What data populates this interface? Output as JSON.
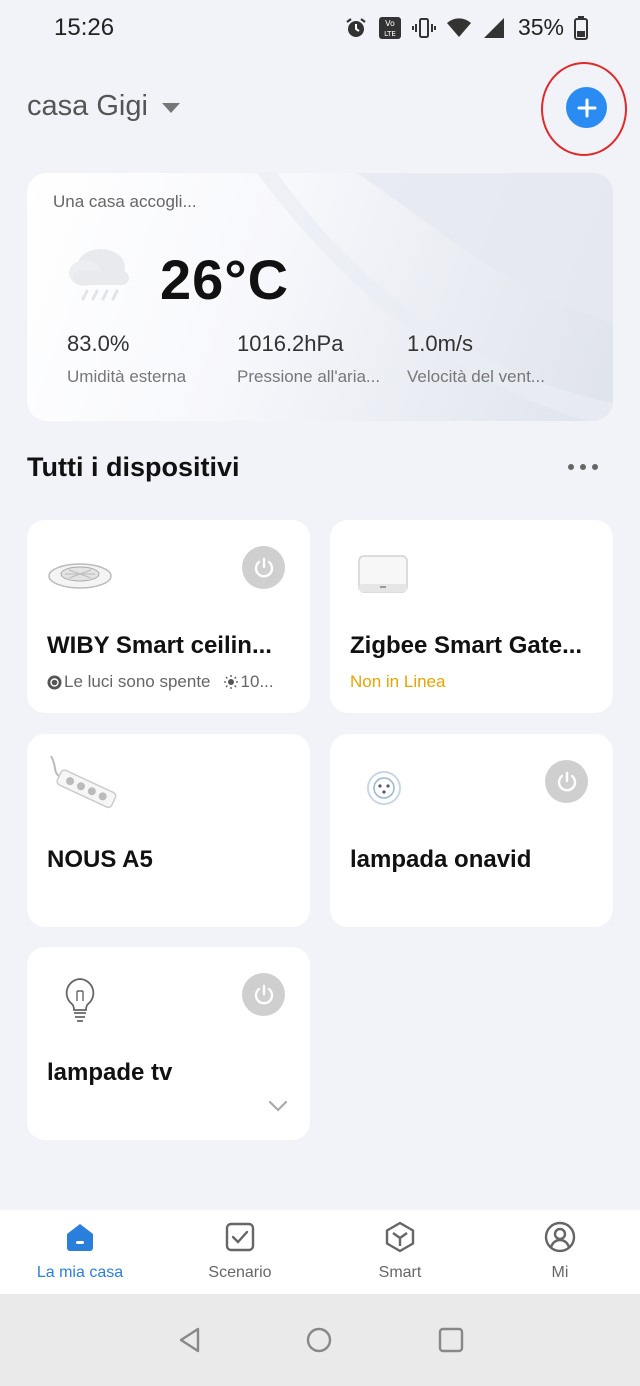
{
  "status_bar": {
    "time": "15:26",
    "battery": "35%",
    "icons": [
      "alarm-icon",
      "volte-icon",
      "vibrate-icon",
      "wifi-icon",
      "signal-icon",
      "battery-icon"
    ]
  },
  "header": {
    "home_name": "casa Gigi",
    "add_button_icon": "plus-icon",
    "highlight_color": "#e02a2a",
    "accent_color": "#2a8cf2"
  },
  "weather": {
    "greeting": "Una casa accogli...",
    "icon": "rain-cloud-icon",
    "temperature": "26°C",
    "stats": [
      {
        "value": "83.0%",
        "label": "Umidità esterna"
      },
      {
        "value": "1016.2hPa",
        "label": "Pressione all'aria..."
      },
      {
        "value": "1.0m/s",
        "label": "Velocità del vent..."
      }
    ]
  },
  "devices_section": {
    "title": "Tutti i dispositivi"
  },
  "devices": [
    {
      "name": "WIBY  Smart ceilin...",
      "status": "Le luci sono spente",
      "extra": "10...",
      "icon": "ceiling-fan-icon",
      "has_power": true
    },
    {
      "name": "Zigbee Smart Gate...",
      "status": "Non in Linea",
      "status_color": "#e8a400",
      "icon": "gateway-icon",
      "has_power": false
    },
    {
      "name": "NOUS A5",
      "icon": "power-strip-icon",
      "has_power": false
    },
    {
      "name": "lampada onavid",
      "icon": "smart-plug-icon",
      "has_power": true
    },
    {
      "name": "lampade tv",
      "icon": "bulb-icon",
      "has_power": true
    }
  ],
  "bottom_nav": [
    {
      "label": "La mia casa",
      "icon": "home-icon",
      "active": true
    },
    {
      "label": "Scenario",
      "icon": "scenario-icon",
      "active": false
    },
    {
      "label": "Smart",
      "icon": "smart-icon",
      "active": false
    },
    {
      "label": "Mi",
      "icon": "profile-icon",
      "active": false
    }
  ]
}
